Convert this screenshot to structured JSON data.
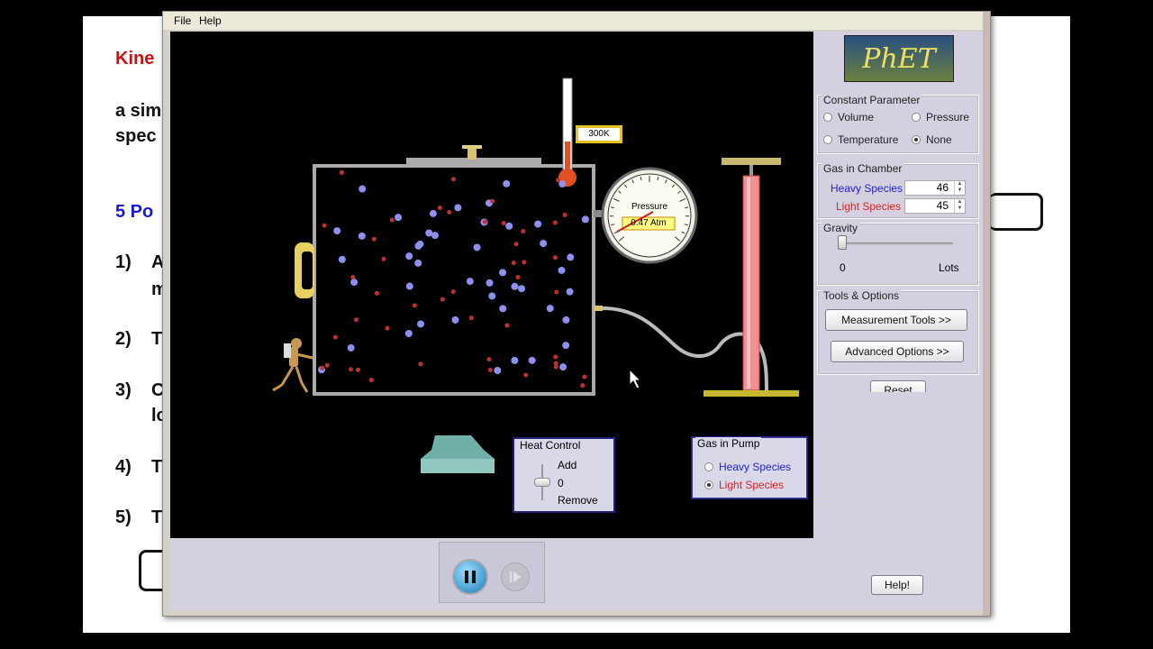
{
  "slide": {
    "title": "Kine",
    "line1": "a sim",
    "line2": "spec",
    "section": "5 Po",
    "items": [
      {
        "num": "1)",
        "text": "A",
        "sub": "m"
      },
      {
        "num": "2)",
        "text": "T"
      },
      {
        "num": "3)",
        "text": "C",
        "sub": "lc"
      },
      {
        "num": "4)",
        "text": "T"
      },
      {
        "num": "5)",
        "text": "T"
      }
    ]
  },
  "menu": {
    "file": "File",
    "help": "Help"
  },
  "sim": {
    "thermometer_reading": "300K",
    "pressure_label": "Pressure",
    "pressure_reading": "0.47 Atm",
    "heat_control": {
      "title": "Heat Control",
      "add": "Add",
      "value": "0",
      "remove": "Remove"
    },
    "gas_in_pump": {
      "title": "Gas in Pump",
      "heavy": "Heavy Species",
      "light": "Light Species",
      "selected": "light"
    },
    "colors": {
      "heavy": "#8f8ff0",
      "light": "#c03030",
      "heavy_text": "#2020d0",
      "light_text": "#e02020"
    }
  },
  "panel": {
    "logo": "PhET",
    "constant_parameter": {
      "title": "Constant Parameter",
      "options": [
        "Volume",
        "Pressure",
        "Temperature",
        "None"
      ],
      "selected": "None"
    },
    "gas_in_chamber": {
      "title": "Gas in Chamber",
      "heavy_label": "Heavy Species",
      "heavy_value": "46",
      "light_label": "Light Species",
      "light_value": "45"
    },
    "gravity": {
      "title": "Gravity",
      "min": "0",
      "max": "Lots",
      "value": 0
    },
    "tools": {
      "title": "Tools & Options",
      "measurement": "Measurement Tools >>",
      "advanced": "Advanced Options >>"
    },
    "reset": "Reset",
    "help": "Help!"
  }
}
